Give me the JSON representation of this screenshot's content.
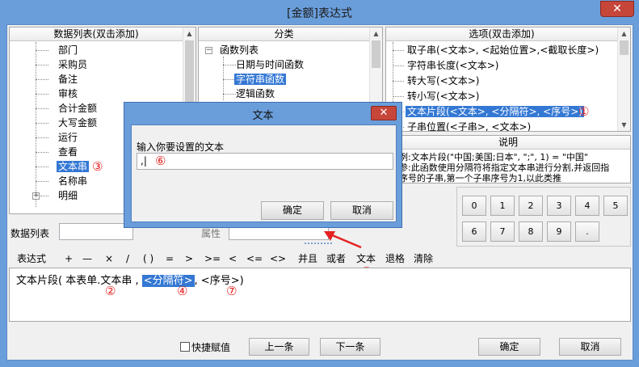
{
  "window": {
    "title": "[金额]表达式",
    "close_label": "✕"
  },
  "panels": {
    "datalist": {
      "header": "数据列表(双击添加)",
      "items": [
        "部门",
        "采购员",
        "备注",
        "审核",
        "合计金额",
        "大写金额",
        "运行",
        "查看",
        "文本串",
        "名称串",
        "明细"
      ]
    },
    "category": {
      "header": "分类",
      "root": "函数列表",
      "items": [
        "日期与时间函数",
        "字符串函数",
        "逻辑函数"
      ]
    },
    "options": {
      "header": "选项(双击添加)",
      "items": [
        "取子串(<文本>, <起始位置>,<截取长度>)",
        "字符串长度(<文本>)",
        "转大写(<文本>)",
        "转小写(<文本>)",
        "文本片段(<文本>, <分隔符>, <序号>)",
        "子串位置(<子串>, <文本>)"
      ]
    },
    "description": {
      "header": "说明",
      "lines": [
        "例:文本片段(\"中国;美国;日本\", \";\", 1) = \"中国\"",
        "参:此函数使用分隔符将指定文本串进行分割,并返回指",
        "序号的子串,第一个子串序号为1,以此类推"
      ]
    }
  },
  "filters": {
    "datalist_label": "数据列表",
    "attr_label": "属性"
  },
  "keypad": {
    "keys": [
      "0",
      "1",
      "2",
      "3",
      "4",
      "5",
      "6",
      "7",
      "8",
      "9",
      "."
    ]
  },
  "toolbar": {
    "label": "表达式",
    "items": [
      "+",
      "—",
      "×",
      "/",
      "( )",
      "=",
      ">",
      ">=",
      "<",
      "<=",
      "<>",
      "并且",
      "或者",
      "文本",
      "退格",
      "清除"
    ]
  },
  "expression": {
    "prefix": "文本片段( 本表单.文本串 , ",
    "selected": "<分隔符>",
    "suffix": ", <序号>)"
  },
  "bottom": {
    "shortcut_label": "快捷赋值",
    "prev": "上一条",
    "next": "下一条",
    "ok": "确定",
    "cancel": "取消"
  },
  "dialog": {
    "title": "文本",
    "close_label": "✕",
    "prompt": "输入你要设置的文本",
    "value": ",|",
    "ok": "确定",
    "cancel": "取消"
  },
  "annotations": {
    "m1": "①",
    "m2": "②",
    "m3": "③",
    "m4": "④",
    "m5": "⑤",
    "m6": "⑥",
    "m7": "⑦"
  },
  "colors": {
    "accent": "#3478d4",
    "titlebar": "#6a9edb",
    "annotation": "#e52222",
    "close": "#c7463a"
  }
}
